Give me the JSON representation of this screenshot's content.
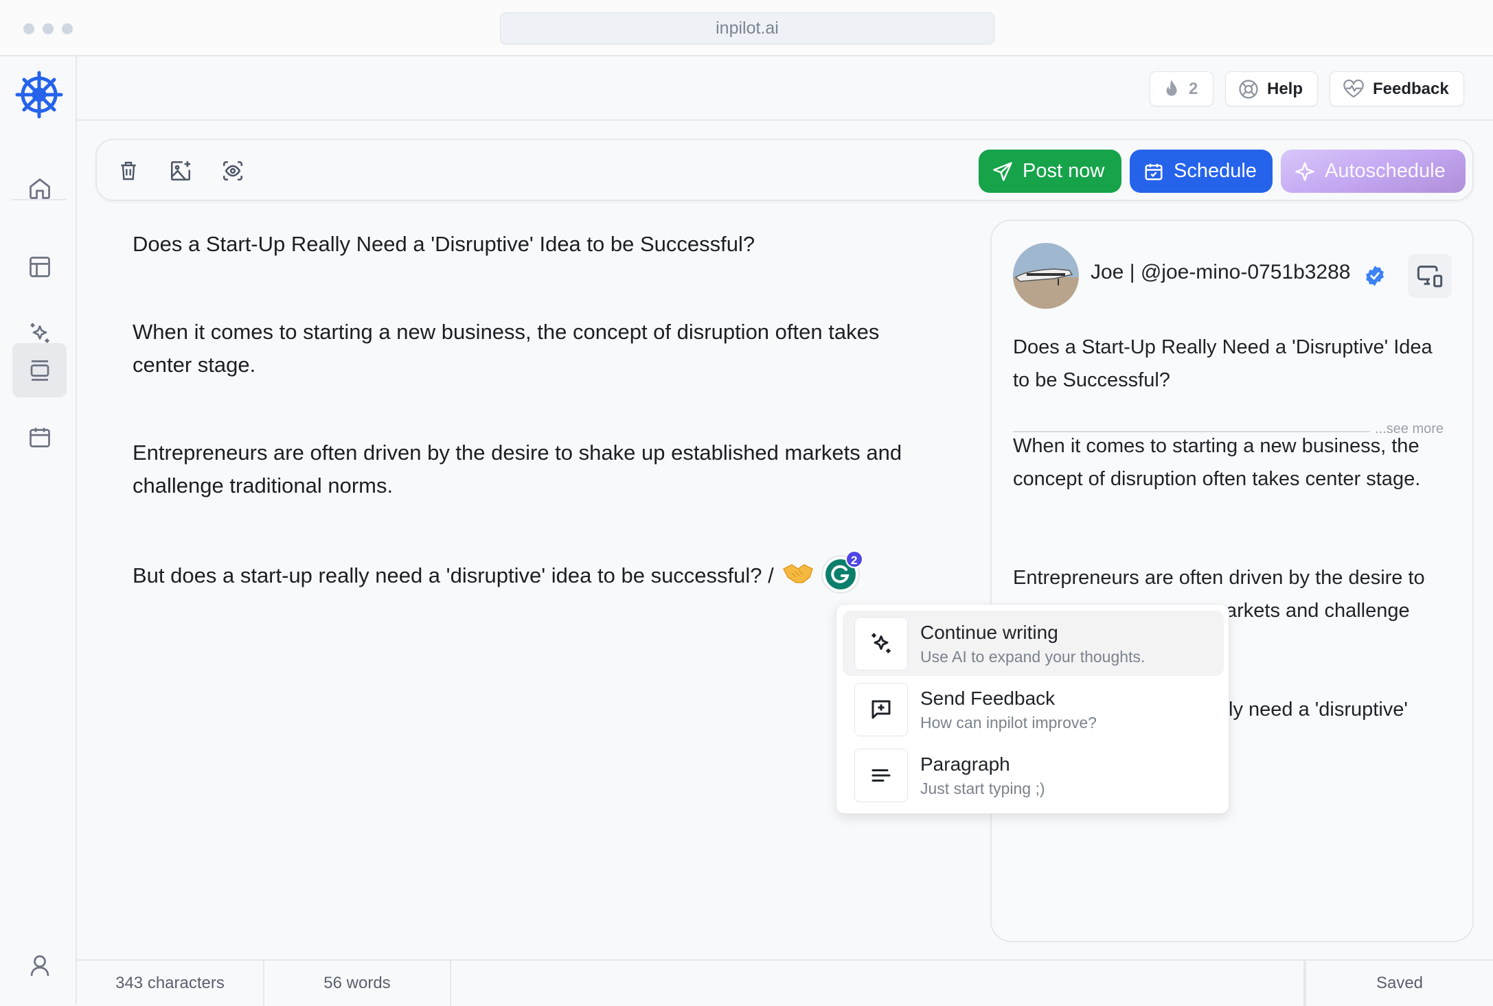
{
  "browser": {
    "url": "inpilot.ai"
  },
  "sidebar": {
    "items": [
      {
        "icon": "home-icon",
        "label": "Home"
      },
      {
        "icon": "layout-icon",
        "label": "Layout"
      },
      {
        "icon": "sparkles-icon",
        "label": "AI"
      },
      {
        "icon": "posts-icon",
        "label": "Posts",
        "active": true
      },
      {
        "icon": "calendar-icon",
        "label": "Calendar"
      }
    ],
    "bottom": {
      "icon": "user-icon",
      "label": "Account"
    }
  },
  "header": {
    "streak_count": "2",
    "help_label": "Help",
    "feedback_label": "Feedback"
  },
  "toolbar": {
    "tools": [
      "delete",
      "add-image",
      "preview"
    ],
    "post_now_label": "Post now",
    "schedule_label": "Schedule",
    "autoschedule_label": "Autoschedule",
    "colors": {
      "post_now": "#16a34a",
      "schedule": "#2563eb",
      "autoschedule": "#c4a8f2"
    }
  },
  "editor": {
    "paragraphs": [
      "Does a Start-Up Really Need a 'Disruptive' Idea to be Successful?",
      "When it comes to starting a new business, the concept of disruption often takes center stage.",
      "Entrepreneurs are often driven by the desire to shake up established markets and challenge traditional norms.",
      "But does a start-up really need a 'disruptive' idea to be successful? /"
    ],
    "inline_badge_count": "2"
  },
  "preview": {
    "author": "Joe | @joe-mino-0751b3288",
    "verified": true,
    "see_more_label": "...see more",
    "title": "Does a Start-Up Really Need a 'Disruptive' Idea to be Successful?",
    "p1": "When it comes to starting a new business, the concept of disruption often takes center stage.",
    "p2_visible": "Entrepreneurs are often driven by the desire to",
    "p2_line2_visible": "arkets and challenge",
    "p3_visible": "ly need a 'disruptive'"
  },
  "slash_menu": {
    "items": [
      {
        "title": "Continue writing",
        "subtitle": "Use AI to expand your thoughts.",
        "icon": "sparkles-icon",
        "highlighted": true
      },
      {
        "title": "Send Feedback",
        "subtitle": "How can inpilot improve?",
        "icon": "message-plus-icon"
      },
      {
        "title": "Paragraph",
        "subtitle": "Just start typing ;)",
        "icon": "text-align-icon"
      }
    ]
  },
  "footer": {
    "characters": "343 characters",
    "words": "56 words",
    "status": "Saved"
  }
}
